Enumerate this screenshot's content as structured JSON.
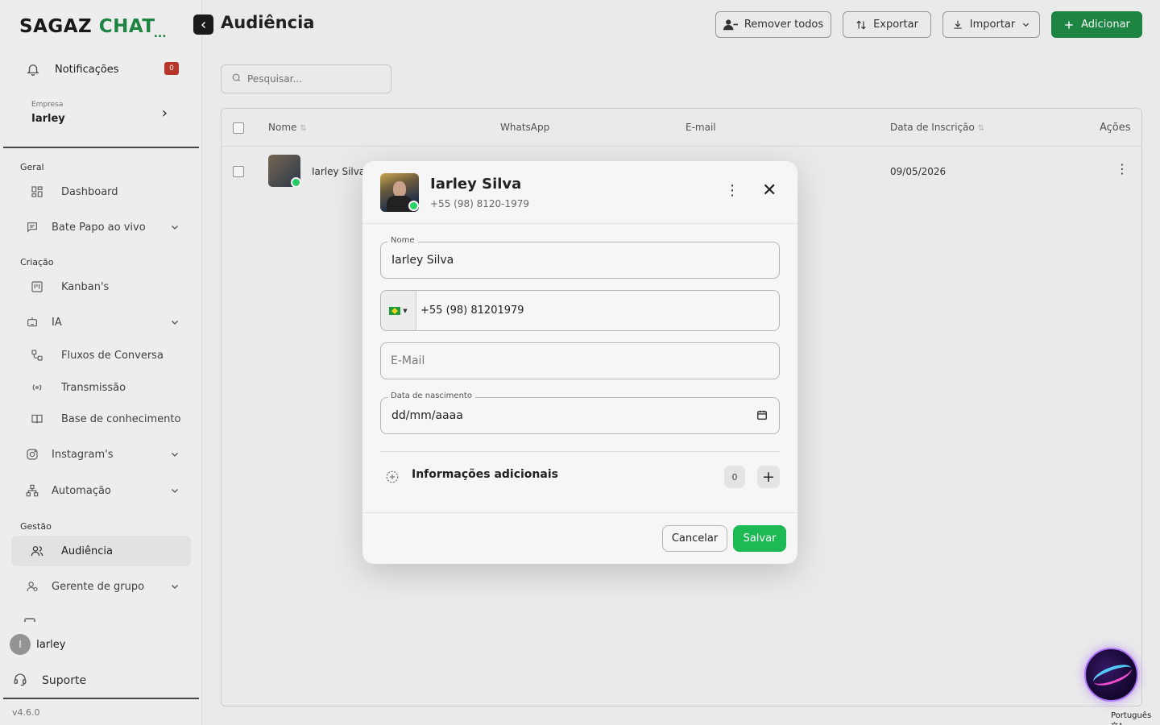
{
  "brand": {
    "name_a": "SAGAZ",
    "name_b": "CHAT",
    "dots": "..."
  },
  "sidebar": {
    "notifications_label": "Notificações",
    "notifications_count": "0",
    "company_caption": "Empresa",
    "company_name": "Iarley",
    "sections": {
      "geral": "Geral",
      "criacao": "Criação",
      "gestao": "Gestão"
    },
    "items": {
      "dashboard": "Dashboard",
      "bate_papo": "Bate Papo ao vivo",
      "kanbans": "Kanban's",
      "ia": "IA",
      "fluxos": "Fluxos de Conversa",
      "transmissao": "Transmissão",
      "base": "Base de conhecimento",
      "instagram": "Instagram's",
      "automacao": "Automação",
      "audiencia": "Audiência",
      "gerente": "Gerente de grupo"
    },
    "user_initial": "I",
    "user_name": "Iarley",
    "support_label": "Suporte",
    "version": "v4.6.0"
  },
  "page": {
    "title": "Audiência",
    "toolbar": {
      "remove_all": "Remover todos",
      "export": "Exportar",
      "import": "Importar",
      "add": "Adicionar"
    },
    "search_placeholder": "Pesquisar..."
  },
  "table": {
    "columns": {
      "name": "Nome",
      "whatsapp": "WhatsApp",
      "email": "E-mail",
      "date": "Data de Inscrição",
      "actions": "Ações"
    },
    "rows": [
      {
        "name": "Iarley Silva",
        "date": "09/05/2026"
      }
    ]
  },
  "modal": {
    "name": "Iarley Silva",
    "phone": "+55 (98) 8120-1979",
    "fields": {
      "name_label": "Nome",
      "name_value": "Iarley Silva",
      "phone_value": "+55 (98) 81201979",
      "email_placeholder": "E-Mail",
      "birth_label": "Data de nascimento",
      "birth_value": "dd/mm/aaaa"
    },
    "additional_label": "Informações adicionais",
    "additional_count": "0",
    "cancel": "Cancelar",
    "save": "Salvar"
  },
  "language": "Português",
  "colors": {
    "brand_green": "#1f8a45",
    "save_green": "#1db954",
    "badge_red": "#c0392b"
  }
}
